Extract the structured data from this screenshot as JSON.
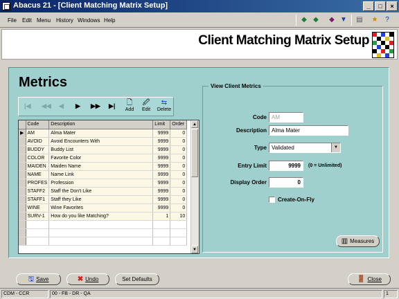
{
  "window": {
    "title": "Abacus 21 - [Client Matching Matrix Setup]"
  },
  "menu": [
    "File",
    "Edit",
    "Menu",
    "History",
    "Windows",
    "Help"
  ],
  "header": {
    "title": "Client Matching Matrix Setup"
  },
  "metrics": {
    "title": "Metrics",
    "nav": {
      "add_label": "Add",
      "edit_label": "Edit",
      "delete_label": "Delete"
    },
    "columns": [
      "Code",
      "Description",
      "Limit",
      "Order"
    ],
    "rows": [
      {
        "code": "AM",
        "description": "Alma Mater",
        "limit": "9999",
        "order": "0"
      },
      {
        "code": "AVOID",
        "description": "Avoid Encounters With",
        "limit": "9999",
        "order": "0"
      },
      {
        "code": "BUDDY",
        "description": "Buddy List",
        "limit": "9999",
        "order": "0"
      },
      {
        "code": "COLOR",
        "description": "Favorite Color",
        "limit": "9999",
        "order": "0"
      },
      {
        "code": "MAIDEN",
        "description": "Maiden Name",
        "limit": "9999",
        "order": "0"
      },
      {
        "code": "NAME",
        "description": "Name Link",
        "limit": "9999",
        "order": "0"
      },
      {
        "code": "PROFES",
        "description": "Profession",
        "limit": "9999",
        "order": "0"
      },
      {
        "code": "STAFF2",
        "description": "Staff the Don't Like",
        "limit": "9999",
        "order": "0"
      },
      {
        "code": "STAFF1",
        "description": "Staff they Like",
        "limit": "9999",
        "order": "0"
      },
      {
        "code": "WINE",
        "description": "Wine Favorites",
        "limit": "9999",
        "order": "0"
      },
      {
        "code": "SURV-1",
        "description": "How do you like Matching?",
        "limit": "1",
        "order": "10"
      }
    ]
  },
  "view": {
    "legend": "View Client Metrics",
    "code_label": "Code",
    "code_value": "AM",
    "description_label": "Description",
    "description_value": "Alma Mater",
    "type_label": "Type",
    "type_value": "Validated",
    "entry_limit_label": "Entry Limit",
    "entry_limit_value": "9999",
    "entry_limit_hint": "(0 = Unlimited)",
    "display_order_label": "Display Order",
    "display_order_value": "0",
    "create_on_fly_label": "Create-On-Fly",
    "measures_label": "Measures"
  },
  "footer": {
    "save_label": "Save",
    "undo_label": "Undo",
    "defaults_label": "Set Defaults",
    "close_label": "Close"
  },
  "status": {
    "left": "CDM - CCR",
    "mid": "00 - FB - DR - QA",
    "right": "1"
  }
}
